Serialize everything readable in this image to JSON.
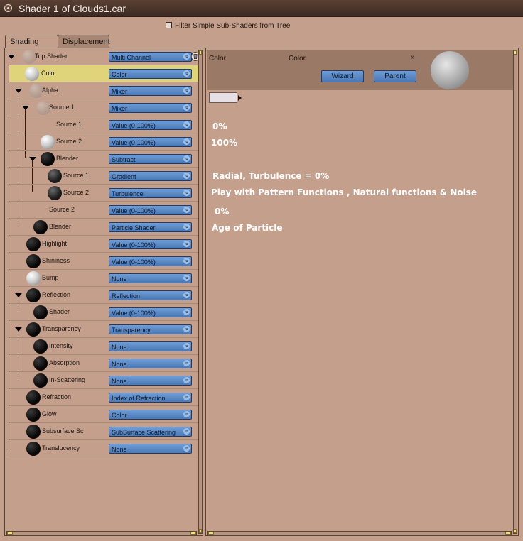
{
  "window": {
    "title": "Shader 1 of Clouds1.car"
  },
  "filter": {
    "label": "Filter Simple Sub-Shaders from Tree"
  },
  "tabs": [
    {
      "label": "Shading"
    },
    {
      "label": "Displacement"
    }
  ],
  "tree": [
    {
      "label": "Top Shader",
      "value": "Multi Channel",
      "sphere": "ghost"
    },
    {
      "label": "Color",
      "value": "Color",
      "sphere": "white"
    },
    {
      "label": "Alpha",
      "value": "Mixer",
      "sphere": "ghost"
    },
    {
      "label": "Source 1",
      "value": "Mixer",
      "sphere": "ghost"
    },
    {
      "label": "Source 1",
      "value": "Value (0-100%)",
      "sphere": "none"
    },
    {
      "label": "Source 2",
      "value": "Value (0-100%)",
      "sphere": "white"
    },
    {
      "label": "Blender",
      "value": "Subtract",
      "sphere": "black"
    },
    {
      "label": "Source 1",
      "value": "Gradient",
      "sphere": "noise"
    },
    {
      "label": "Source 2",
      "value": "Turbulence",
      "sphere": "noise"
    },
    {
      "label": "Source 2",
      "value": "Value (0-100%)",
      "sphere": "none"
    },
    {
      "label": "Blender",
      "value": "Particle Shader",
      "sphere": "black"
    },
    {
      "label": "Highlight",
      "value": "Value (0-100%)",
      "sphere": "black"
    },
    {
      "label": "Shininess",
      "value": "Value (0-100%)",
      "sphere": "black"
    },
    {
      "label": "Bump",
      "value": "None",
      "sphere": "white"
    },
    {
      "label": "Reflection",
      "value": "Reflection",
      "sphere": "black"
    },
    {
      "label": "Shader",
      "value": "Value (0-100%)",
      "sphere": "black"
    },
    {
      "label": "Transparency",
      "value": "Transparency",
      "sphere": "black"
    },
    {
      "label": "Intensity",
      "value": "None",
      "sphere": "black"
    },
    {
      "label": "Absorption",
      "value": "None",
      "sphere": "black"
    },
    {
      "label": "In-Scattering",
      "value": "None",
      "sphere": "black"
    },
    {
      "label": "Refraction",
      "value": "Index of Refraction",
      "sphere": "black"
    },
    {
      "label": "Glow",
      "value": "Color",
      "sphere": "black"
    },
    {
      "label": "Subsurface Sc",
      "value": "SubSurface Scattering",
      "sphere": "black"
    },
    {
      "label": "Translucency",
      "value": "None",
      "sphere": "black"
    }
  ],
  "detail": {
    "label_left": "Color",
    "label_right": "Color",
    "wizard_label": "Wizard",
    "parent_label": "Parent"
  },
  "notes": [
    "0%",
    "100%",
    "Radial, Turbulence = 0%",
    "Play with Pattern Functions , Natural functions & Noise",
    "0%",
    "Age of Particle"
  ],
  "colors": {
    "background": "#c4a08c",
    "selected_row": "#e0d47a",
    "dropdown": "#5a88c6",
    "title_bar": "#4a342a"
  }
}
